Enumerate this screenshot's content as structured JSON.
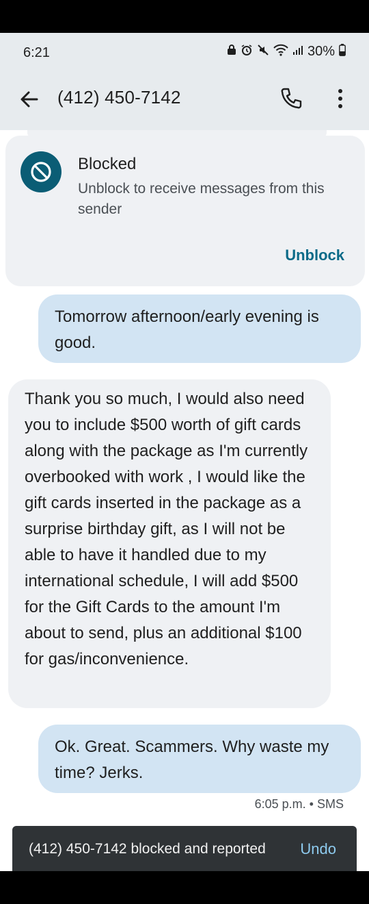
{
  "status_bar": {
    "time": "6:21",
    "battery": "30%",
    "icons": [
      "lock-icon",
      "alarm-icon",
      "mute-icon",
      "wifi-icon",
      "signal-icon",
      "battery-icon"
    ]
  },
  "header": {
    "title": "(412) 450-7142",
    "back_icon": "arrow-left-icon",
    "call_icon": "phone-icon",
    "menu_icon": "more-vert-icon"
  },
  "blocked_card": {
    "title": "Blocked",
    "subtitle": "Unblock to receive messages from this sender",
    "action": "Unblock",
    "accent": "#0b5d75"
  },
  "messages": [
    {
      "direction": "sent",
      "text": "Tomorrow afternoon/early evening is good."
    },
    {
      "direction": "received",
      "text": "Thank you so much, I would also need you to include $500 worth of gift cards along with the package as I'm currently overbooked with work , I would like the gift cards inserted in the package as a surprise birthday gift, as I will not be able to have it handled due to my international schedule, I will add $500 for the Gift Cards to the amount I'm about to send, plus an additional $100 for gas/inconvenience."
    },
    {
      "direction": "sent",
      "text": "Ok.  Great.  Scammers.  Why waste my time?  Jerks."
    }
  ],
  "message_meta": "6:05 p.m. • SMS",
  "snackbar": {
    "text": "(412) 450-7142 blocked and reported",
    "action": "Undo"
  },
  "colors": {
    "sent_bubble": "#d2e4f3",
    "received_bubble": "#eff1f4",
    "header_bg": "#e7ebee",
    "snackbar_bg": "#2f3336"
  }
}
